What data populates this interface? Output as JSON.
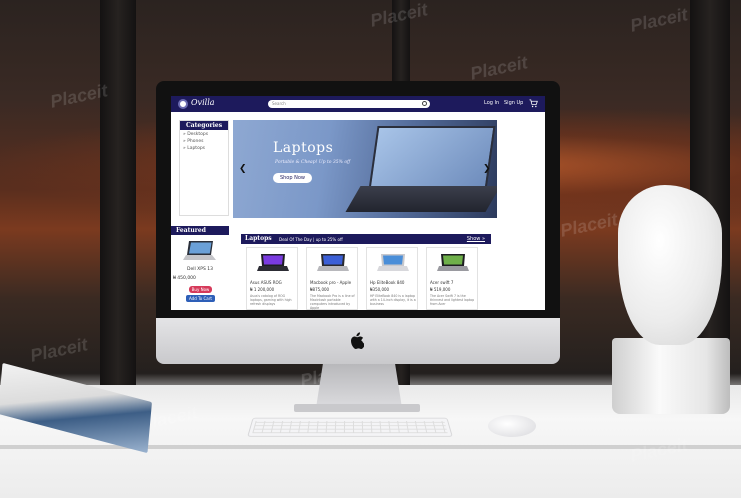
{
  "watermark": "Placeit",
  "site": {
    "logo": "Ovilla",
    "search_placeholder": "Search",
    "nav": {
      "login": "Log In",
      "signup": "Sign Up"
    },
    "categories": {
      "title": "Categories",
      "items": [
        "Desktops",
        "Phones",
        "Laptops"
      ]
    },
    "hero": {
      "title": "Laptops",
      "subtitle": "Portable & Cheap! Up to 35% off",
      "cta": "Shop Now",
      "prev": "❮",
      "next": "❯"
    },
    "featured": {
      "title": "Featured",
      "product_name": "Dell XPS 13",
      "price": "₦ 450,000",
      "buy_label": "Buy Now",
      "cart_label": "Add To Cart"
    },
    "products": {
      "title": "Laptops",
      "subtitle": "Deal Of The Day | up to 25% off",
      "show_label": "Show »",
      "items": [
        {
          "name": "Asus ASUS ROG",
          "price": "₦ 1 200,000",
          "desc": "Asus's catalog of ROG laptops, gaming with high refresh displays"
        },
        {
          "name": "Macbook pro - Apple",
          "price": "₦875,000",
          "desc": "The Macbook Pro is a line of Macintosh portable computers introduced by Apple"
        },
        {
          "name": "Hp EliteBook 840",
          "price": "₦350,000",
          "desc": "HP EliteBook 840 is a laptop with a 14-inch display, it is a business"
        },
        {
          "name": "Acer swift 7",
          "price": "₦ 519,000",
          "desc": "The Acer Swift 7 is the thinnest and lightest laptop from Acer"
        }
      ]
    }
  }
}
